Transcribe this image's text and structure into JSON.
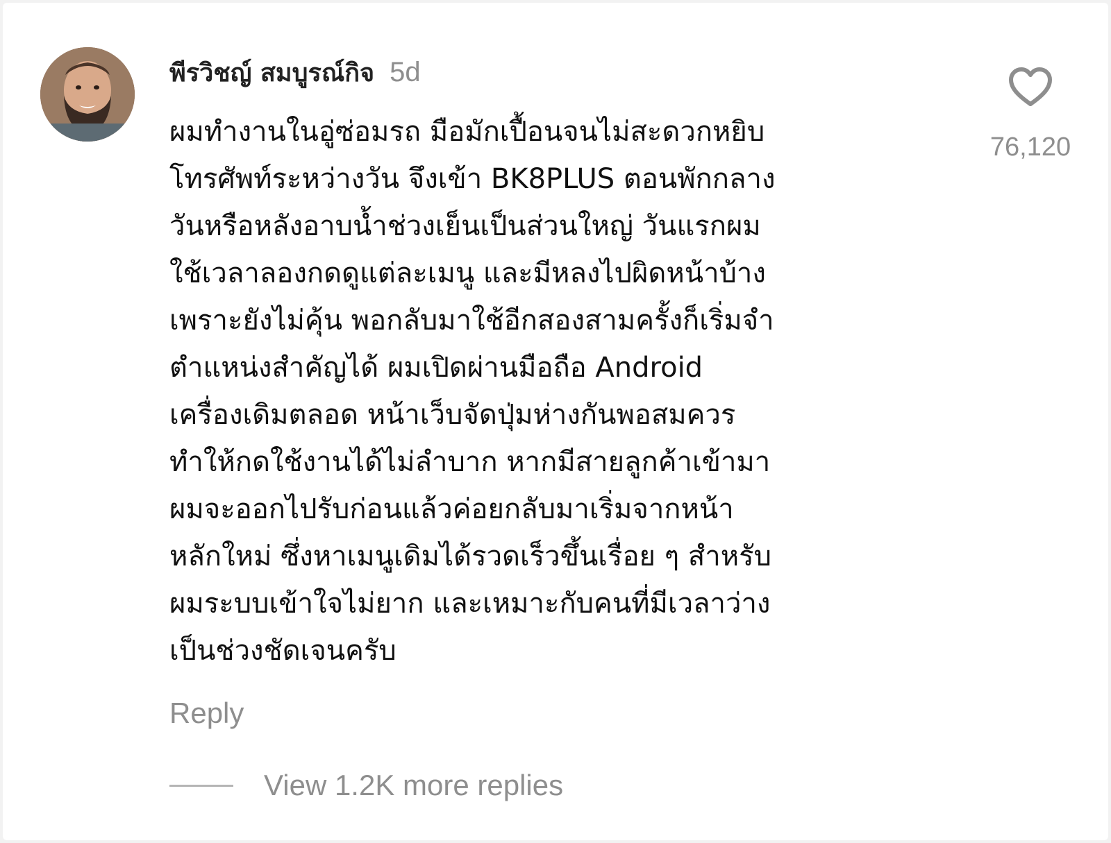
{
  "comment": {
    "username": "พีรวิชญ์ สมบูรณ์กิจ",
    "timestamp": "5d",
    "text": "ผมทำงานในอู่ซ่อมรถ มือมักเปื้อนจนไม่สะดวกหยิบ\nโทรศัพท์ระหว่างวัน จึงเข้า BK8PLUS ตอนพักกลาง\nวันหรือหลังอาบน้ำช่วงเย็นเป็นส่วนใหญ่ วันแรกผม\nใช้เวลาลองกดดูแต่ละเมนู และมีหลงไปผิดหน้าบ้าง\nเพราะยังไม่คุ้น พอกลับมาใช้อีกสองสามครั้งก็เริ่มจำ\nตำแหน่งสำคัญได้ ผมเปิดผ่านมือถือ Android\nเครื่องเดิมตลอด หน้าเว็บจัดปุ่มห่างกันพอสมควร\nทำให้กดใช้งานได้ไม่ลำบาก หากมีสายลูกค้าเข้ามา\nผมจะออกไปรับก่อนแล้วค่อยกลับมาเริ่มจากหน้า\nหลักใหม่ ซึ่งหาเมนูเดิมได้รวดเร็วขึ้นเรื่อย ๆ สำหรับ\nผมระบบเข้าใจไม่ยาก และเหมาะกับคนที่มีเวลาว่าง\nเป็นช่วงชัดเจนครับ",
    "like_count": "76,120",
    "reply_label": "Reply",
    "view_replies_label": "View 1.2K more replies"
  },
  "icons": {
    "like": "heart-outline-icon",
    "avatar": "profile-photo"
  },
  "colors": {
    "primary_text": "#111111",
    "secondary_text": "#8e8e8e",
    "background": "#ffffff"
  }
}
